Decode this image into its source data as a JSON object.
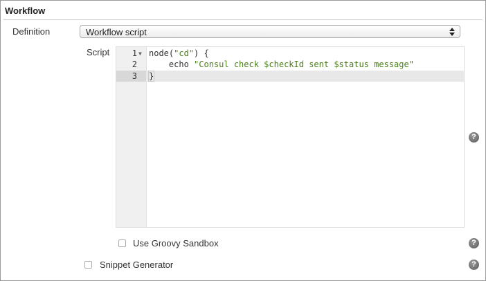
{
  "section": {
    "title": "Workflow"
  },
  "definition": {
    "label": "Definition",
    "selected": "Workflow script"
  },
  "script": {
    "label": "Script",
    "lines": [
      {
        "number": "1",
        "parts": [
          "node(",
          "\"cd\"",
          ") {"
        ]
      },
      {
        "number": "2",
        "parts": [
          "    echo ",
          "\"Consul check $checkId sent $status message\"",
          ""
        ]
      },
      {
        "number": "3",
        "parts": [
          "}",
          "",
          ""
        ]
      }
    ]
  },
  "options": {
    "sandbox_label": "Use Groovy Sandbox",
    "snippet_label": "Snippet Generator"
  },
  "help": {
    "glyph": "?"
  }
}
